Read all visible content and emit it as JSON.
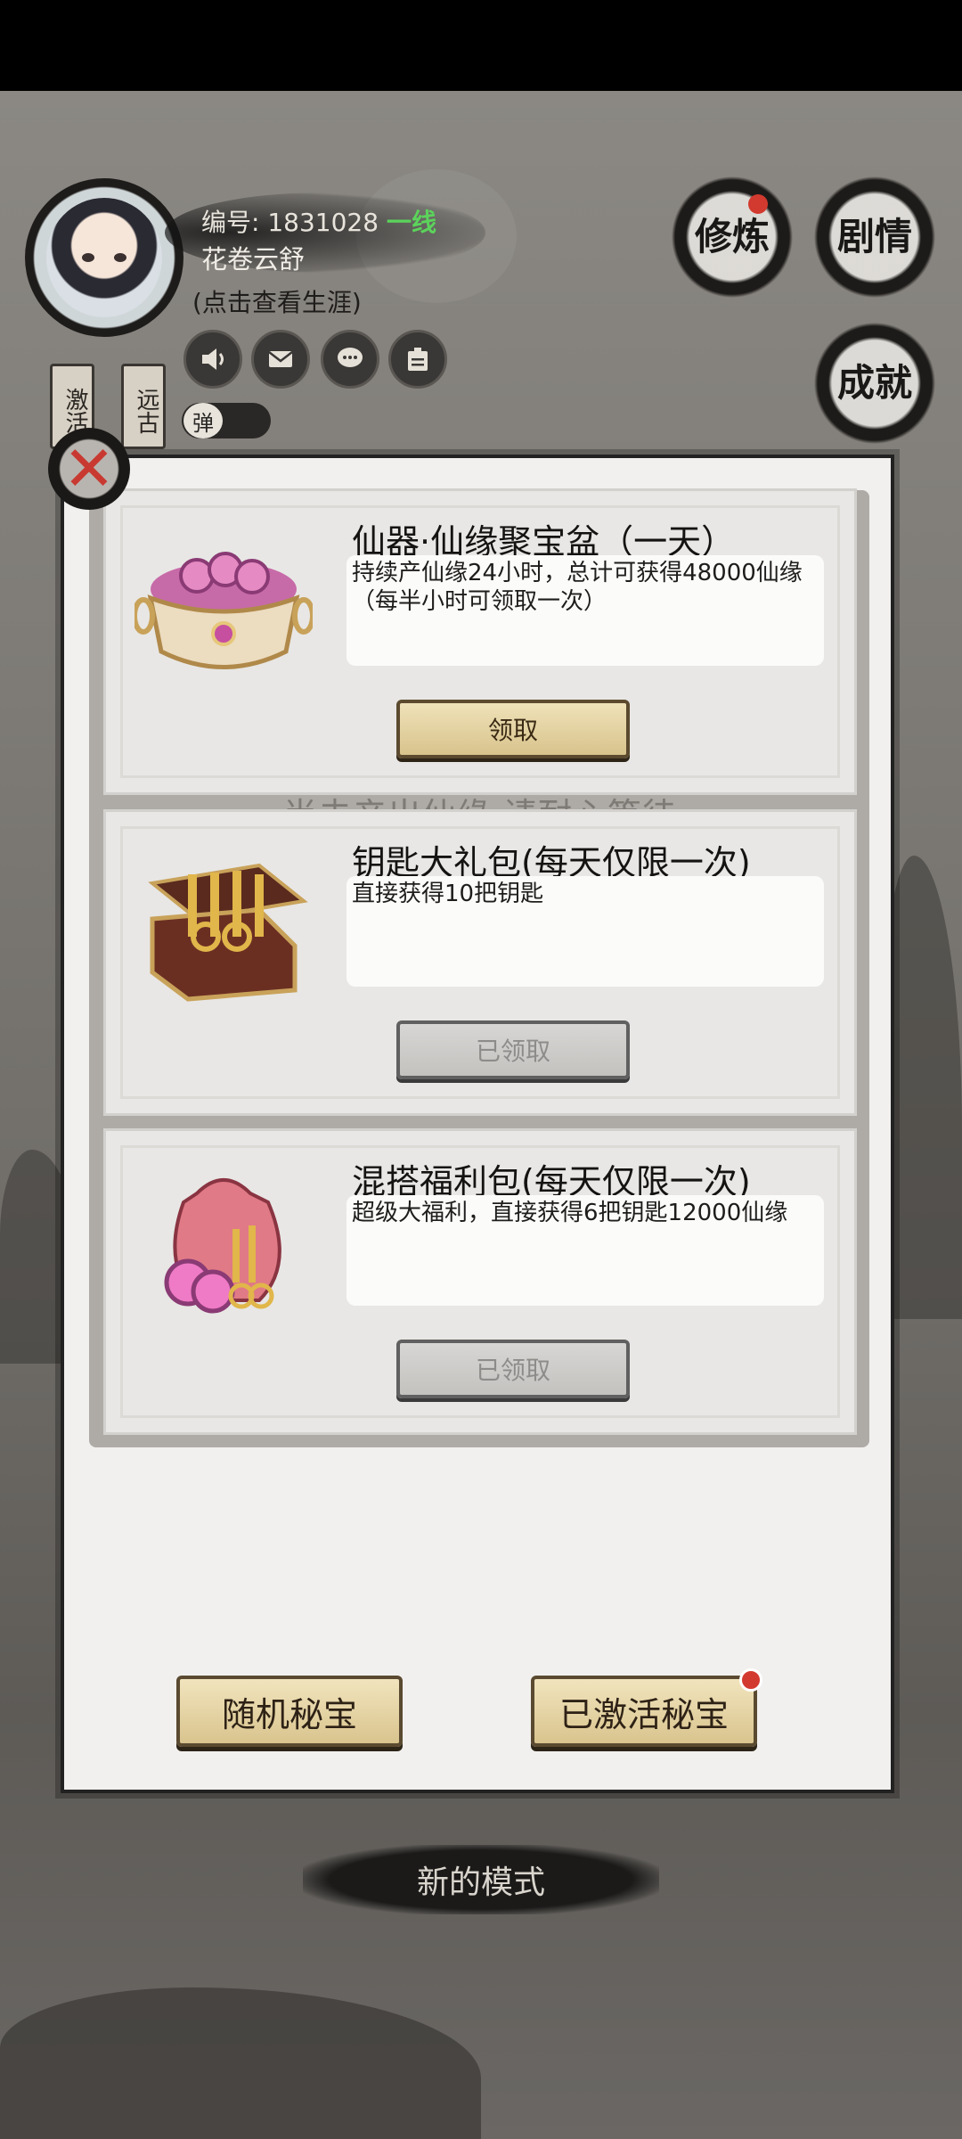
{
  "header": {
    "id_label": "编号:",
    "id_value": "1831028",
    "line": "一线",
    "name": "花卷云舒",
    "career_link": "(点击查看生涯)",
    "toggle_label": "弹",
    "tags": [
      "激活",
      "远古"
    ]
  },
  "menu": {
    "cultivate": "修炼",
    "story": "剧情",
    "achievement": "成就"
  },
  "cards": [
    {
      "title": "仙器·仙缘聚宝盆（一天）",
      "description": "持续产仙缘24小时，总计可获得48000仙缘（每半小时可领取一次）",
      "button": "领取"
    },
    {
      "title": "钥匙大礼包(每天仅限一次)",
      "description": "直接获得10把钥匙",
      "button": "已领取"
    },
    {
      "title": "混搭福利包(每天仅限一次)",
      "description": "超级大福利，直接获得6把钥匙12000仙缘",
      "button": "已领取"
    }
  ],
  "notice": "尚未产出仙缘,请耐心等待",
  "bottom": {
    "random_treasure": "随机秘宝",
    "activated_treasure": "已激活秘宝"
  },
  "mode_banner": "新的模式",
  "colors": {
    "accent_gold": "#d9c48e",
    "notification_red": "#d33a2f",
    "line_green": "#5bd35b"
  }
}
